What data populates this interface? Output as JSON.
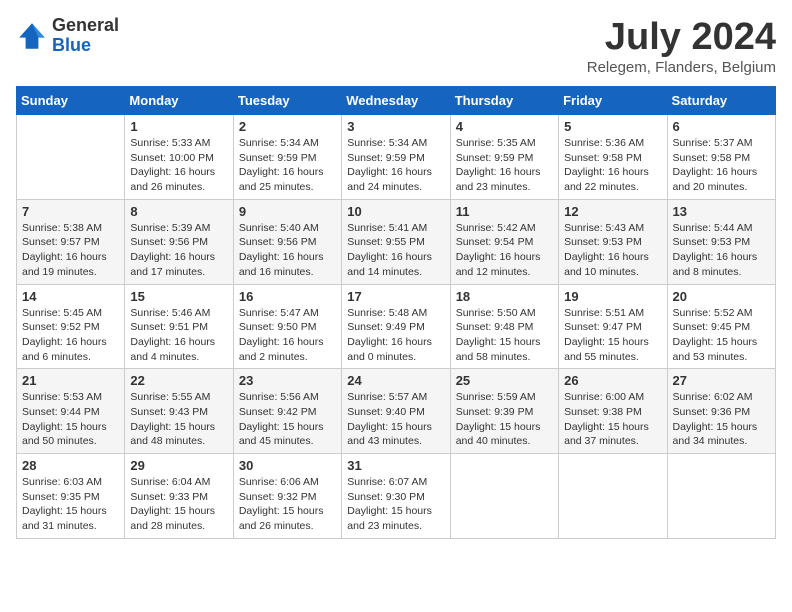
{
  "header": {
    "logo_general": "General",
    "logo_blue": "Blue",
    "month_year": "July 2024",
    "location": "Relegem, Flanders, Belgium"
  },
  "calendar": {
    "days_of_week": [
      "Sunday",
      "Monday",
      "Tuesday",
      "Wednesday",
      "Thursday",
      "Friday",
      "Saturday"
    ],
    "weeks": [
      [
        {
          "day": "",
          "info": ""
        },
        {
          "day": "1",
          "info": "Sunrise: 5:33 AM\nSunset: 10:00 PM\nDaylight: 16 hours\nand 26 minutes."
        },
        {
          "day": "2",
          "info": "Sunrise: 5:34 AM\nSunset: 9:59 PM\nDaylight: 16 hours\nand 25 minutes."
        },
        {
          "day": "3",
          "info": "Sunrise: 5:34 AM\nSunset: 9:59 PM\nDaylight: 16 hours\nand 24 minutes."
        },
        {
          "day": "4",
          "info": "Sunrise: 5:35 AM\nSunset: 9:59 PM\nDaylight: 16 hours\nand 23 minutes."
        },
        {
          "day": "5",
          "info": "Sunrise: 5:36 AM\nSunset: 9:58 PM\nDaylight: 16 hours\nand 22 minutes."
        },
        {
          "day": "6",
          "info": "Sunrise: 5:37 AM\nSunset: 9:58 PM\nDaylight: 16 hours\nand 20 minutes."
        }
      ],
      [
        {
          "day": "7",
          "info": "Sunrise: 5:38 AM\nSunset: 9:57 PM\nDaylight: 16 hours\nand 19 minutes."
        },
        {
          "day": "8",
          "info": "Sunrise: 5:39 AM\nSunset: 9:56 PM\nDaylight: 16 hours\nand 17 minutes."
        },
        {
          "day": "9",
          "info": "Sunrise: 5:40 AM\nSunset: 9:56 PM\nDaylight: 16 hours\nand 16 minutes."
        },
        {
          "day": "10",
          "info": "Sunrise: 5:41 AM\nSunset: 9:55 PM\nDaylight: 16 hours\nand 14 minutes."
        },
        {
          "day": "11",
          "info": "Sunrise: 5:42 AM\nSunset: 9:54 PM\nDaylight: 16 hours\nand 12 minutes."
        },
        {
          "day": "12",
          "info": "Sunrise: 5:43 AM\nSunset: 9:53 PM\nDaylight: 16 hours\nand 10 minutes."
        },
        {
          "day": "13",
          "info": "Sunrise: 5:44 AM\nSunset: 9:53 PM\nDaylight: 16 hours\nand 8 minutes."
        }
      ],
      [
        {
          "day": "14",
          "info": "Sunrise: 5:45 AM\nSunset: 9:52 PM\nDaylight: 16 hours\nand 6 minutes."
        },
        {
          "day": "15",
          "info": "Sunrise: 5:46 AM\nSunset: 9:51 PM\nDaylight: 16 hours\nand 4 minutes."
        },
        {
          "day": "16",
          "info": "Sunrise: 5:47 AM\nSunset: 9:50 PM\nDaylight: 16 hours\nand 2 minutes."
        },
        {
          "day": "17",
          "info": "Sunrise: 5:48 AM\nSunset: 9:49 PM\nDaylight: 16 hours\nand 0 minutes."
        },
        {
          "day": "18",
          "info": "Sunrise: 5:50 AM\nSunset: 9:48 PM\nDaylight: 15 hours\nand 58 minutes."
        },
        {
          "day": "19",
          "info": "Sunrise: 5:51 AM\nSunset: 9:47 PM\nDaylight: 15 hours\nand 55 minutes."
        },
        {
          "day": "20",
          "info": "Sunrise: 5:52 AM\nSunset: 9:45 PM\nDaylight: 15 hours\nand 53 minutes."
        }
      ],
      [
        {
          "day": "21",
          "info": "Sunrise: 5:53 AM\nSunset: 9:44 PM\nDaylight: 15 hours\nand 50 minutes."
        },
        {
          "day": "22",
          "info": "Sunrise: 5:55 AM\nSunset: 9:43 PM\nDaylight: 15 hours\nand 48 minutes."
        },
        {
          "day": "23",
          "info": "Sunrise: 5:56 AM\nSunset: 9:42 PM\nDaylight: 15 hours\nand 45 minutes."
        },
        {
          "day": "24",
          "info": "Sunrise: 5:57 AM\nSunset: 9:40 PM\nDaylight: 15 hours\nand 43 minutes."
        },
        {
          "day": "25",
          "info": "Sunrise: 5:59 AM\nSunset: 9:39 PM\nDaylight: 15 hours\nand 40 minutes."
        },
        {
          "day": "26",
          "info": "Sunrise: 6:00 AM\nSunset: 9:38 PM\nDaylight: 15 hours\nand 37 minutes."
        },
        {
          "day": "27",
          "info": "Sunrise: 6:02 AM\nSunset: 9:36 PM\nDaylight: 15 hours\nand 34 minutes."
        }
      ],
      [
        {
          "day": "28",
          "info": "Sunrise: 6:03 AM\nSunset: 9:35 PM\nDaylight: 15 hours\nand 31 minutes."
        },
        {
          "day": "29",
          "info": "Sunrise: 6:04 AM\nSunset: 9:33 PM\nDaylight: 15 hours\nand 28 minutes."
        },
        {
          "day": "30",
          "info": "Sunrise: 6:06 AM\nSunset: 9:32 PM\nDaylight: 15 hours\nand 26 minutes."
        },
        {
          "day": "31",
          "info": "Sunrise: 6:07 AM\nSunset: 9:30 PM\nDaylight: 15 hours\nand 23 minutes."
        },
        {
          "day": "",
          "info": ""
        },
        {
          "day": "",
          "info": ""
        },
        {
          "day": "",
          "info": ""
        }
      ]
    ]
  }
}
